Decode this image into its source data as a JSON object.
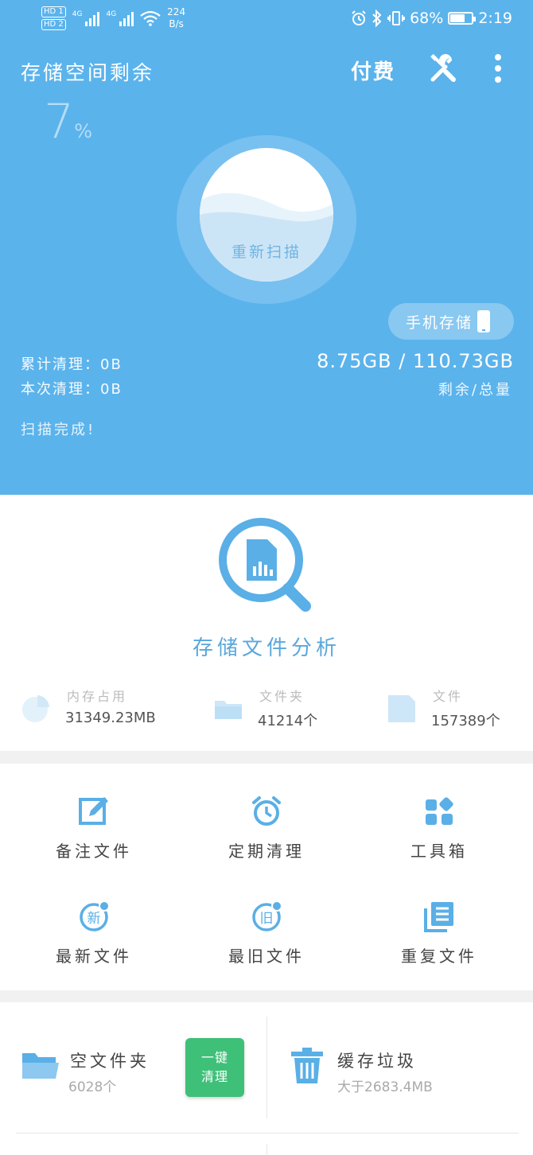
{
  "status_bar": {
    "hd1": "HD 1",
    "hd2": "HD 2",
    "net1": "4G",
    "net2": "4G",
    "speed_value": "224",
    "speed_unit": "B/s",
    "battery_percent": "68%",
    "battery_level": 0.68,
    "time": "2:19",
    "icons": [
      "alarm-icon",
      "bluetooth-icon",
      "vibrate-icon",
      "battery-icon"
    ]
  },
  "header": {
    "title": "存储空间剩余",
    "pay_label": "付费",
    "percent_value": "7",
    "percent_symbol": "%",
    "rescan_label": "重新扫描",
    "phone_storage_label": "手机存储",
    "cumulative_label": "累计清理：0B",
    "current_label": "本次清理：0B",
    "capacity": "8.75GB / 110.73GB",
    "capacity_label": "剩余/总量",
    "scan_status": "扫描完成!",
    "accent_color": "#5bb3ec"
  },
  "analysis": {
    "title": "存储文件分析",
    "metrics": [
      {
        "label": "内存占用",
        "value": "31349.23MB",
        "icon": "pie-chart-icon"
      },
      {
        "label": "文件夹",
        "value": "41214个",
        "icon": "folder-icon"
      },
      {
        "label": "文件",
        "value": "157389个",
        "icon": "file-icon"
      }
    ]
  },
  "features": [
    {
      "label": "备注文件",
      "icon": "edit-note-icon"
    },
    {
      "label": "定期清理",
      "icon": "alarm-clock-icon"
    },
    {
      "label": "工具箱",
      "icon": "toolbox-icon"
    },
    {
      "label": "最新文件",
      "icon": "new-file-icon",
      "glyph": "新"
    },
    {
      "label": "最旧文件",
      "icon": "old-file-icon",
      "glyph": "旧"
    },
    {
      "label": "重复文件",
      "icon": "duplicate-file-icon"
    }
  ],
  "bottom": {
    "empty_folder": {
      "title": "空文件夹",
      "count": "6028个"
    },
    "one_click": {
      "line1": "一键",
      "line2": "清理",
      "color": "#3ec078"
    },
    "cache": {
      "title": "缓存垃圾",
      "size": "大于2683.4MB"
    }
  }
}
